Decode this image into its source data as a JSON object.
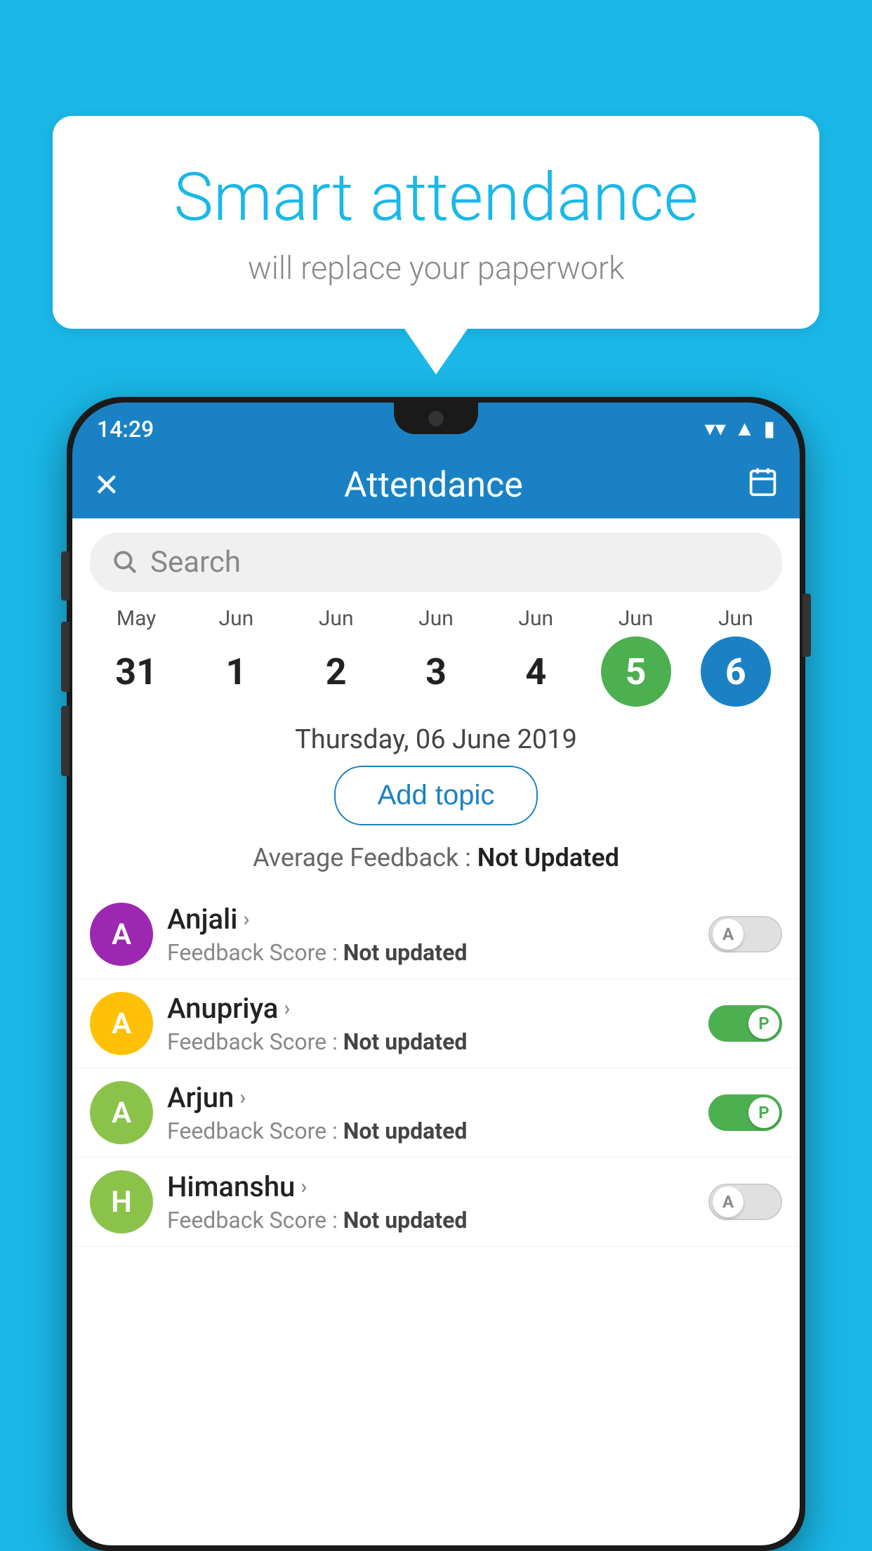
{
  "background_color": "#1ab8e8",
  "bubble": {
    "title": "Smart attendance",
    "subtitle": "will replace your paperwork"
  },
  "status_bar": {
    "time": "14:29",
    "wifi": "▲",
    "signal": "▲",
    "battery": "▌"
  },
  "header": {
    "close_label": "✕",
    "title": "Attendance",
    "calendar_icon": "📅"
  },
  "search": {
    "placeholder": "Search"
  },
  "calendar": {
    "days": [
      {
        "month": "May",
        "date": "31",
        "state": "normal"
      },
      {
        "month": "Jun",
        "date": "1",
        "state": "normal"
      },
      {
        "month": "Jun",
        "date": "2",
        "state": "normal"
      },
      {
        "month": "Jun",
        "date": "3",
        "state": "normal"
      },
      {
        "month": "Jun",
        "date": "4",
        "state": "normal"
      },
      {
        "month": "Jun",
        "date": "5",
        "state": "today"
      },
      {
        "month": "Jun",
        "date": "6",
        "state": "selected"
      }
    ]
  },
  "selected_date_label": "Thursday, 06 June 2019",
  "add_topic_label": "Add topic",
  "avg_feedback_prefix": "Average Feedback : ",
  "avg_feedback_value": "Not Updated",
  "students": [
    {
      "name": "Anjali",
      "avatar_letter": "A",
      "avatar_color": "#9c27b0",
      "feedback_label": "Feedback Score : ",
      "feedback_value": "Not updated",
      "toggle": "off",
      "toggle_letter": "A"
    },
    {
      "name": "Anupriya",
      "avatar_letter": "A",
      "avatar_color": "#ffc107",
      "feedback_label": "Feedback Score : ",
      "feedback_value": "Not updated",
      "toggle": "on",
      "toggle_letter": "P"
    },
    {
      "name": "Arjun",
      "avatar_letter": "A",
      "avatar_color": "#8bc34a",
      "feedback_label": "Feedback Score : ",
      "feedback_value": "Not updated",
      "toggle": "on",
      "toggle_letter": "P"
    },
    {
      "name": "Himanshu",
      "avatar_letter": "H",
      "avatar_color": "#8bc34a",
      "feedback_label": "Feedback Score : ",
      "feedback_value": "Not updated",
      "toggle": "off",
      "toggle_letter": "A"
    }
  ]
}
